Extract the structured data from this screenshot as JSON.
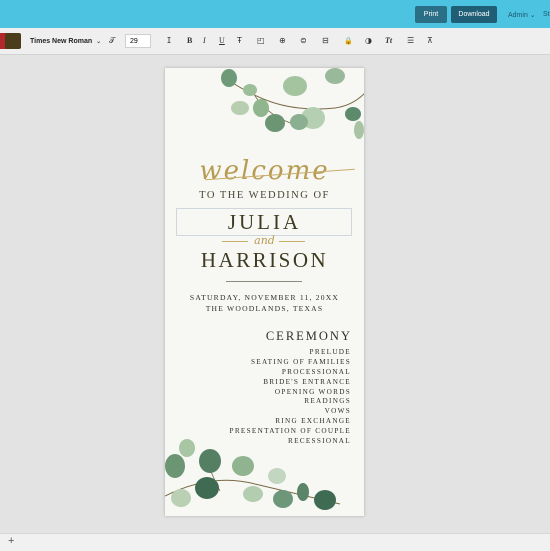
{
  "topbar": {
    "print_label": "Print",
    "download_label": "Download",
    "admin_label": "Admin",
    "admin_chevron": "⌄",
    "cut_label": "St"
  },
  "toolbar": {
    "font_family": "Times New Roman",
    "font_size": "29",
    "colors": [
      "#b3282b",
      "#4b3d1c"
    ],
    "icons": {
      "text_effect": "𝒯",
      "text_size": "ⵊ",
      "bold": "B",
      "italic": "I",
      "underline": "U",
      "strike": "Ŧ",
      "transform": "◰",
      "group": "⊕",
      "layers": "⊜",
      "effects": "⊟",
      "lock": "🔒",
      "theme": "◑",
      "case": "Tt",
      "list": "☰",
      "align": "⊼"
    }
  },
  "program": {
    "welcome": "welcome",
    "wedding_of": "TO THE WEDDING OF",
    "name1": "JULIA",
    "and": "and",
    "name2": "HARRISON",
    "date": "SATURDAY, NOVEMBER 11, 20XX",
    "place": "THE WOODLANDS, TEXAS",
    "ceremony_title": "CEREMONY",
    "items": [
      "PRELUDE",
      "SEATING OF FAMILIES",
      "PROCESSIONAL",
      "BRIDE'S ENTRANCE",
      "OPENING WORDS",
      "READINGS",
      "VOWS",
      "RING EXCHANGE",
      "PRESENTATION OF COUPLE",
      "RECESSIONAL"
    ]
  },
  "footer": {
    "add_label": "+"
  }
}
